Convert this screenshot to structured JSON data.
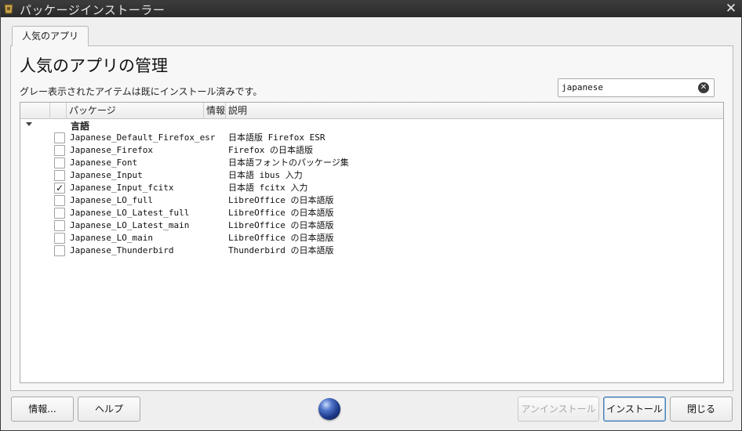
{
  "window": {
    "title": "パッケージインストーラー"
  },
  "tab": {
    "label": "人気のアプリ"
  },
  "main": {
    "heading": "人気のアプリの管理",
    "subtext": "グレー表示されたアイテムは既にインストール済みです。"
  },
  "search": {
    "value": "japanese"
  },
  "tree": {
    "columns": {
      "package": "パッケージ",
      "info": "情報",
      "description": "説明"
    },
    "group": {
      "label": "言語"
    },
    "rows": [
      {
        "name": "Japanese_Default_Firefox_esr",
        "description": "日本語版 Firefox ESR",
        "checked": ""
      },
      {
        "name": "Japanese_Firefox",
        "description": "Firefox の日本語版",
        "checked": ""
      },
      {
        "name": "Japanese_Font",
        "description": "日本語フォントのパッケージ集",
        "checked": ""
      },
      {
        "name": "Japanese_Input",
        "description": "日本語 ibus 入力",
        "checked": ""
      },
      {
        "name": "Japanese_Input_fcitx",
        "description": "日本語 fcitx 入力",
        "checked": "✓"
      },
      {
        "name": "Japanese_LO_full",
        "description": "LibreOffice の日本語版",
        "checked": ""
      },
      {
        "name": "Japanese_LO_Latest_full",
        "description": "LibreOffice の日本語版",
        "checked": ""
      },
      {
        "name": "Japanese_LO_Latest_main",
        "description": "LibreOffice の日本語版",
        "checked": ""
      },
      {
        "name": "Japanese_LO_main",
        "description": "LibreOffice の日本語版",
        "checked": ""
      },
      {
        "name": "Japanese_Thunderbird",
        "description": "Thunderbird の日本語版",
        "checked": ""
      }
    ]
  },
  "buttons": {
    "info": "情報...",
    "help": "ヘルプ",
    "uninstall": "アンインストール",
    "install": "インストール",
    "close": "閉じる"
  },
  "icons": {
    "app": "app-icon",
    "close": "close-icon",
    "clear": "clear-search-icon",
    "globe": "globe-icon"
  }
}
